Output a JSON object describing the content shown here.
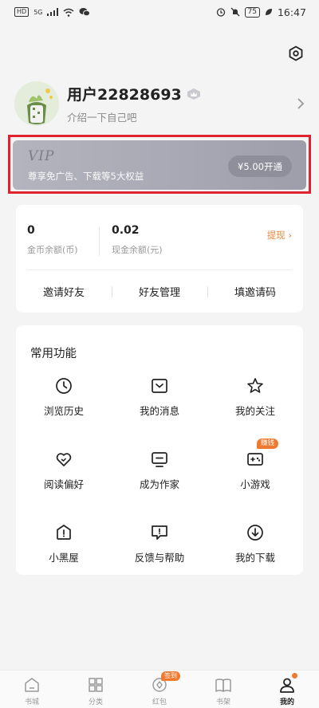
{
  "status_bar": {
    "hd_badge": "HD",
    "network": "5G",
    "battery": "75",
    "time": "16:47"
  },
  "profile": {
    "username": "用户22828693",
    "intro": "介绍一下自己吧"
  },
  "vip": {
    "logo": "VIP",
    "description": "尊享免广告、下载等5大权益",
    "button_label": "¥5.00开通"
  },
  "wallet": {
    "coins_value": "0",
    "coins_label": "金币余额(币)",
    "cash_value": "0.02",
    "cash_label": "现金余额(元)",
    "withdraw_label": "提现 ›",
    "actions": [
      "邀请好友",
      "好友管理",
      "填邀请码"
    ]
  },
  "functions": {
    "title": "常用功能",
    "items": [
      {
        "label": "浏览历史",
        "icon": "clock-icon"
      },
      {
        "label": "我的消息",
        "icon": "message-icon"
      },
      {
        "label": "我的关注",
        "icon": "star-icon"
      },
      {
        "label": "阅读偏好",
        "icon": "heart-icon"
      },
      {
        "label": "成为作家",
        "icon": "monitor-icon"
      },
      {
        "label": "小游戏",
        "icon": "gamepad-icon",
        "tag": "赚钱"
      },
      {
        "label": "小黑屋",
        "icon": "house-alert-icon"
      },
      {
        "label": "反馈与帮助",
        "icon": "feedback-icon"
      },
      {
        "label": "我的下载",
        "icon": "download-icon"
      }
    ]
  },
  "bottom_nav": {
    "items": [
      {
        "label": "书城",
        "icon": "home-icon"
      },
      {
        "label": "分类",
        "icon": "grid-icon"
      },
      {
        "label": "红包",
        "icon": "coin-icon",
        "tag": "签到"
      },
      {
        "label": "书架",
        "icon": "book-icon"
      },
      {
        "label": "我的",
        "icon": "user-icon",
        "active": true
      }
    ]
  },
  "colors": {
    "accent": "#ef7a2f",
    "vip_bg": "#a7a8b3",
    "highlight": "#e0242f"
  }
}
